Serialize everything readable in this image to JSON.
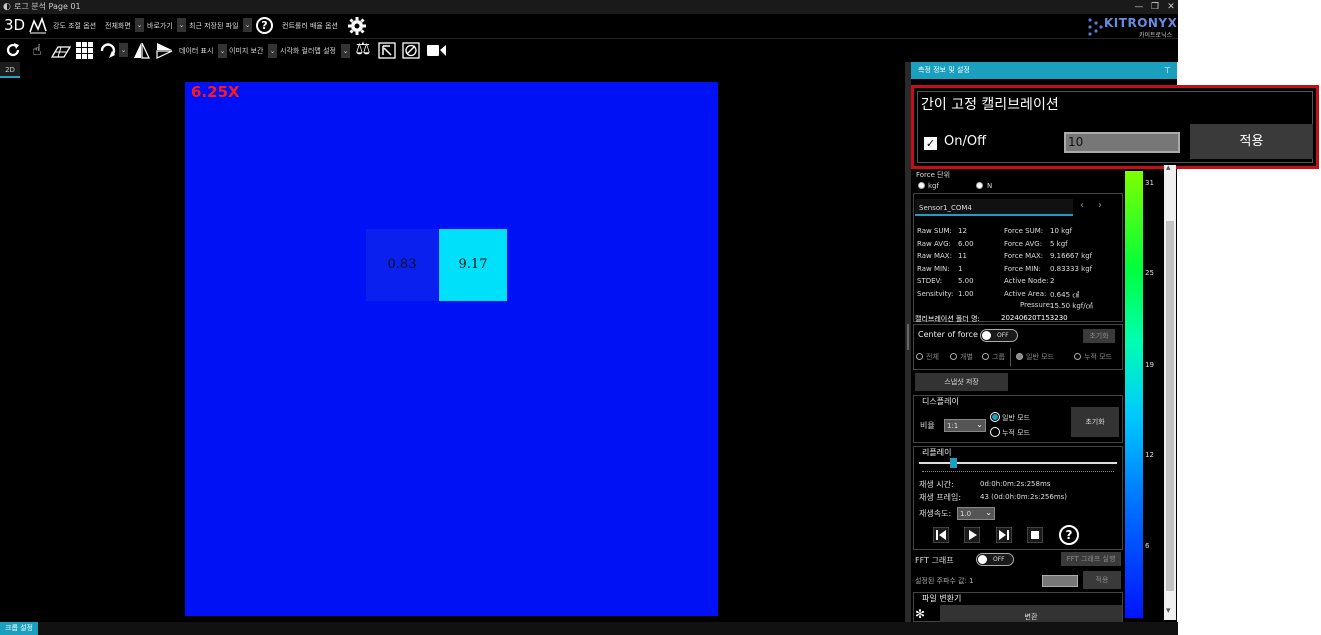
{
  "window": {
    "title": "로그 분석 Page 01",
    "minimize": "—",
    "restore": "❐",
    "close": "✕"
  },
  "toolbar1": {
    "btn_3d": "3D",
    "intensity_label": "강도 조절 옵션",
    "fullscreen_label": "전체화면",
    "shortcut_label": "바로가기",
    "recent_label": "최근 저장된 파일",
    "help": "?",
    "controller_label": "컨트롤러 배율 옵션"
  },
  "logo": {
    "brand": "KITRONYX",
    "sub": "카이트로닉스"
  },
  "toolbar2": {
    "data_display_label": "데이터 표시",
    "image_interp_label": "이미지 보간",
    "colormap_label": "시각화 컬러맵 설정"
  },
  "view": {
    "tab_label": "2D",
    "zoom": "6.25X",
    "cells": [
      {
        "value": "0.83"
      },
      {
        "value": "9.17"
      }
    ]
  },
  "panel": {
    "header": "측정 정보 및 설정",
    "pin": "⊤"
  },
  "calibration": {
    "title": "간이 고정 캘리브레이션",
    "onoff_label": "On/Off",
    "checked": true,
    "value": "10",
    "apply": "적용"
  },
  "force_unit": {
    "label": "Force 단위",
    "kgf": "kgf",
    "n": "N",
    "selected": "kgf"
  },
  "sensor_tab": {
    "label": "Sensor1_COM4",
    "prev": "‹",
    "next": "›"
  },
  "stats_left": [
    {
      "k": "Raw SUM:",
      "v": "12"
    },
    {
      "k": "Raw AVG:",
      "v": "6.00"
    },
    {
      "k": "Raw MAX:",
      "v": "11"
    },
    {
      "k": "Raw MIN:",
      "v": "1"
    },
    {
      "k": "STDEV:",
      "v": "5.00"
    },
    {
      "k": "Sensitvity:",
      "v": "1.00"
    }
  ],
  "stats_right": [
    {
      "k": "Force SUM:",
      "v": "10 kgf"
    },
    {
      "k": "Force AVG:",
      "v": "5 kgf"
    },
    {
      "k": "Force MAX:",
      "v": "9.16667 kgf"
    },
    {
      "k": "Force MIN:",
      "v": "0.83333 kgf"
    },
    {
      "k": "Active Node:",
      "v": "2"
    },
    {
      "k": "Active Area:",
      "v": "0.645 ㎠"
    }
  ],
  "pressure": {
    "k": "Pressure:",
    "v": "15.50 kgf/㎠"
  },
  "calib_folder": {
    "k": "캘리브레이션 폴더 명:",
    "v": "20240620T153230"
  },
  "center_of_force": {
    "label": "Center of force",
    "toggle": "OFF",
    "reset": "초기화",
    "opt_all": "전체",
    "opt_each": "개별",
    "opt_group": "그룹",
    "opt_normal": "일반 모드",
    "opt_accum": "누적 모드"
  },
  "snapshot": {
    "label": "스냅샷 저장"
  },
  "display": {
    "title": "디스플레이",
    "ratio_label": "비율",
    "ratio_value": "1:1",
    "mode_normal": "일반 모드",
    "mode_accum": "누적 모드",
    "selected": "일반 모드",
    "reset": "초기화"
  },
  "replay": {
    "title": "리플레이",
    "progress": 0.17,
    "time_label": "재생 시간:",
    "time_value": "0d:0h:0m:2s:258ms",
    "frame_label": "재생 프레임:",
    "frame_value": "43 (0d:0h:0m:2s:256ms)",
    "speed_label": "재생속도:",
    "speed_value": "1.0",
    "help": "?"
  },
  "fft": {
    "label": "FFT 그래프",
    "toggle": "OFF",
    "run": "FFT 그래프 실행",
    "freq_label": "설정된 주파수 값: 1",
    "apply": "적용"
  },
  "converter": {
    "title": "파일 변환기",
    "btn": "변환"
  },
  "colorbar": {
    "labels": [
      "31",
      "25",
      "19",
      "12",
      "6"
    ]
  },
  "scroll": {
    "up": "▴",
    "down": "▾"
  },
  "status": {
    "tab": "크롭 설정"
  },
  "colors": {
    "accent": "#1a9fbf",
    "canvas": "#0012f5",
    "cell_low": "#0a20ee",
    "cell_high": "#00e0fa",
    "highlight": "#c40f14",
    "zoom": "#ff1a1a"
  }
}
